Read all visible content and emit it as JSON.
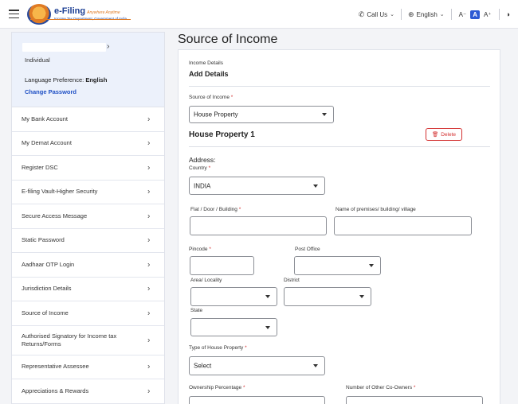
{
  "header": {
    "logo_main": "e-Filing",
    "logo_tag": "Anywhere Anytime",
    "logo_sub": "Income Tax Department, Government of India",
    "call_us": "Call Us",
    "language": "English",
    "font_decrease": "A⁻",
    "font_normal": "A",
    "font_increase": "A⁺"
  },
  "profile": {
    "type": "Individual",
    "language_label": "Language Preference:",
    "language_value": "English",
    "change_password": "Change Password"
  },
  "sidebar": {
    "items": [
      {
        "label": "My Bank Account"
      },
      {
        "label": "My Demat Account"
      },
      {
        "label": "Register DSC"
      },
      {
        "label": "E-filing Vault-Higher Security"
      },
      {
        "label": "Secure Access Message"
      },
      {
        "label": "Static Password"
      },
      {
        "label": "Aadhaar OTP Login"
      },
      {
        "label": "Jurisdiction Details"
      },
      {
        "label": "Source of Income"
      },
      {
        "label": "Authorised Signatory for Income tax Returns/Forms"
      },
      {
        "label": "Representative Assessee"
      },
      {
        "label": "Appreciations & Rewards"
      }
    ]
  },
  "main": {
    "title": "Source of Income",
    "section_label": "Income Details",
    "section_title": "Add Details",
    "source_label": "Source of Income",
    "source_value": "House Property",
    "property_title": "House Property 1",
    "delete_label": "Delete",
    "address_heading": "Address:",
    "country_label": "Country",
    "country_value": "INDIA",
    "flat_label": "Flat / Door / Building",
    "premises_label": "Name of premises/ building/ village",
    "pincode_label": "Pincode",
    "post_office_label": "Post Office",
    "area_label": "Area/ Locality",
    "district_label": "District",
    "state_label": "State",
    "type_label": "Type of House Property",
    "type_value": "Select",
    "ownership_label": "Ownership Percentage",
    "coowners_label": "Number of Other Co-Owners"
  },
  "colors": {
    "accent": "#1e4fc4",
    "danger": "#d32f2f",
    "profile_bg": "#ecf1fb"
  }
}
